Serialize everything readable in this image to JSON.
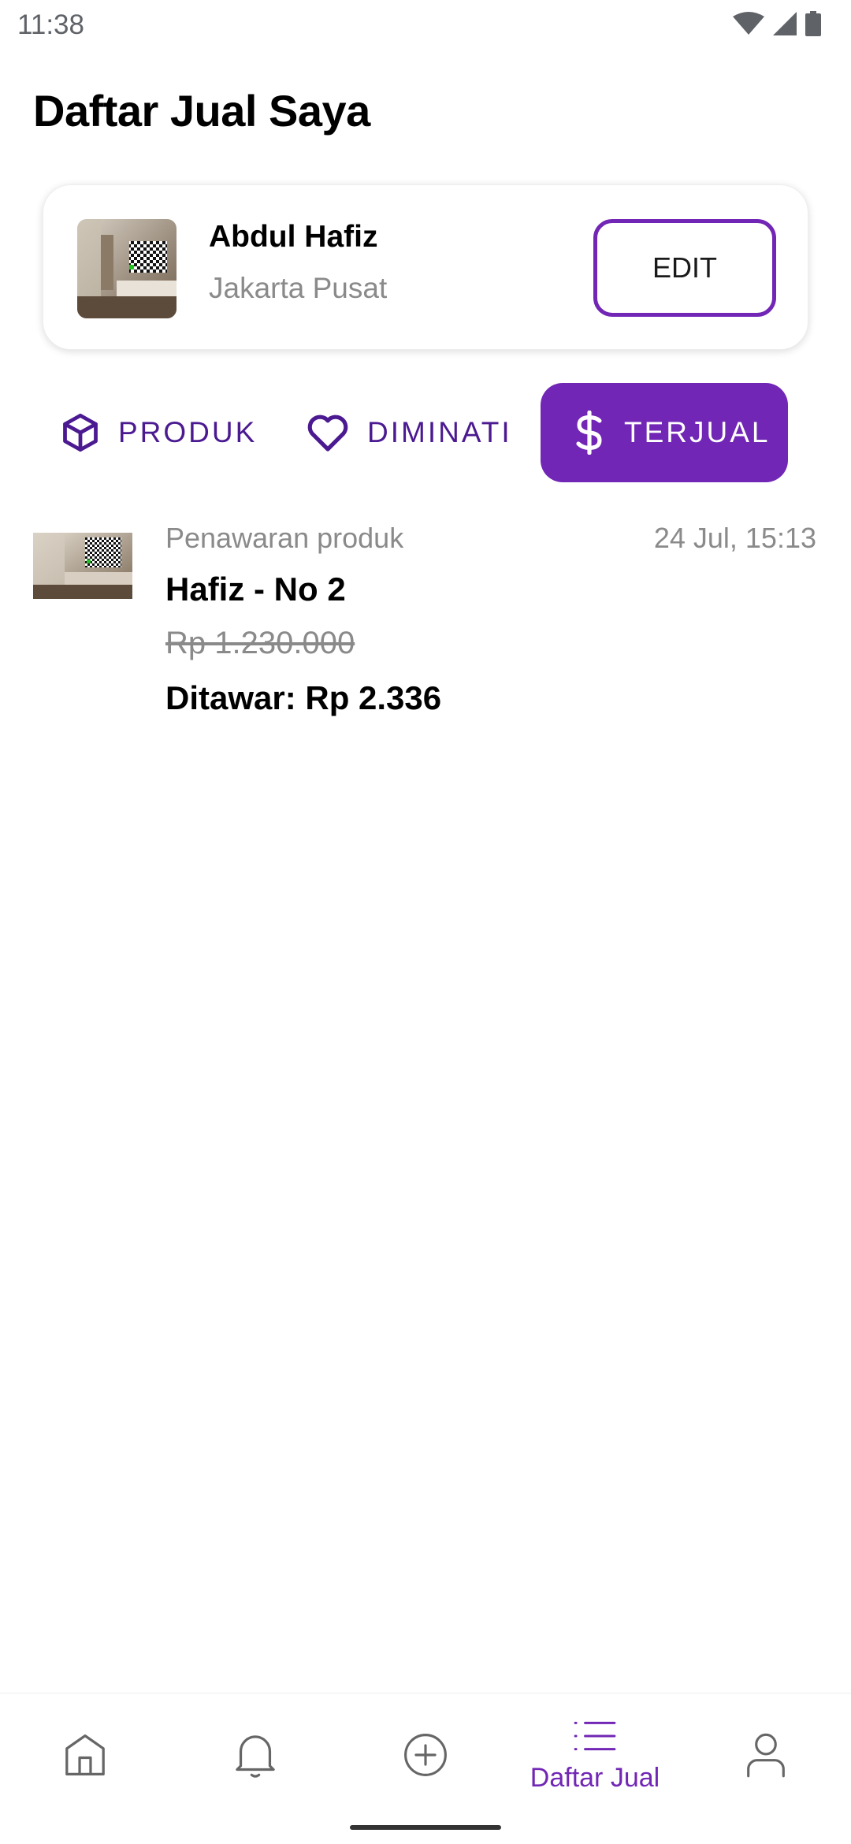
{
  "status_bar": {
    "time": "11:38",
    "icons": [
      "wifi-icon",
      "signal-icon",
      "battery-icon"
    ]
  },
  "page": {
    "title": "Daftar Jual Saya"
  },
  "seller": {
    "name": "Abdul Hafiz",
    "city": "Jakarta Pusat",
    "edit_label": "EDIT"
  },
  "tabs": [
    {
      "label": "PRODUK",
      "icon": "box-icon",
      "selected": false
    },
    {
      "label": "DIMINATI",
      "icon": "heart-icon",
      "selected": false
    },
    {
      "label": "TERJUAL",
      "icon": "dollar-icon",
      "selected": true
    }
  ],
  "notifications": [
    {
      "type": "Penawaran produk",
      "time": "24 Jul, 15:13",
      "product": "Hafiz - No 2",
      "original_price": "Rp 1.230.000",
      "offer": "Ditawar: Rp 2.336"
    }
  ],
  "bottom_nav": {
    "items": [
      {
        "icon": "home-icon",
        "label": ""
      },
      {
        "icon": "bell-icon",
        "label": ""
      },
      {
        "icon": "plus-circle-icon",
        "label": ""
      },
      {
        "icon": "list-icon",
        "label": "Daftar Jual",
        "active": true
      },
      {
        "icon": "user-icon",
        "label": ""
      }
    ]
  },
  "colors": {
    "accent": "#7126B5",
    "tab_text": "#4B1A91",
    "muted_text": "#8A8A8A"
  }
}
